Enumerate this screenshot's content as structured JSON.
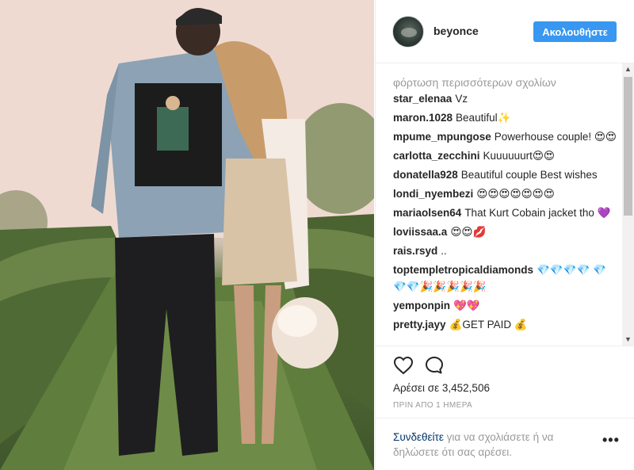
{
  "post": {
    "username": "beyonce",
    "follow_label": "Ακολουθήστε",
    "load_more": "φόρτωση περισσότερων σχολίων",
    "comments": [
      {
        "user": "star_elenaa",
        "text": "Vz"
      },
      {
        "user": "maron.1028",
        "text": "Beautiful✨"
      },
      {
        "user": "mpume_mpungose",
        "text": "Powerhouse couple! 😍😍"
      },
      {
        "user": "carlotta_zecchini",
        "text": "Kuuuuuurt😍😍"
      },
      {
        "user": "donatella928",
        "text": "Beautiful couple Best wishes"
      },
      {
        "user": "londi_nyembezi",
        "text": "😍😍😍😍😍😍😍"
      },
      {
        "user": "mariaolsen64",
        "text": "That Kurt Cobain jacket tho 💜"
      },
      {
        "user": "loviissaa.a",
        "text": "😍😍💋"
      },
      {
        "user": "rais.rsyd",
        "text": ".."
      },
      {
        "user": "toptempletropicaldiamonds",
        "text": "💎💎💎💎 💎💎💎🎉🎉🎉🎉🎉"
      },
      {
        "user": "yemponpin",
        "text": "💖💖"
      },
      {
        "user": "pretty.jayy",
        "text": "💰GET PAID 💰"
      }
    ],
    "likes": "Αρέσει σε 3,452,506",
    "time": "ΠΡΙΝ ΑΠΟ 1 ΗΜΕΡΑ",
    "login_link": "Συνδεθείτε",
    "login_rest": " για να σχολιάσετε ή να δηλώσετε ότι σας αρέσει.",
    "more_options": "•••"
  },
  "icons": {
    "heart": "heart-outline-icon",
    "comment": "speech-bubble-icon",
    "scroll_up": "▲",
    "scroll_down": "▼"
  },
  "colors": {
    "accent": "#3897f0",
    "link": "#003569",
    "muted": "#999999",
    "text": "#262626"
  }
}
